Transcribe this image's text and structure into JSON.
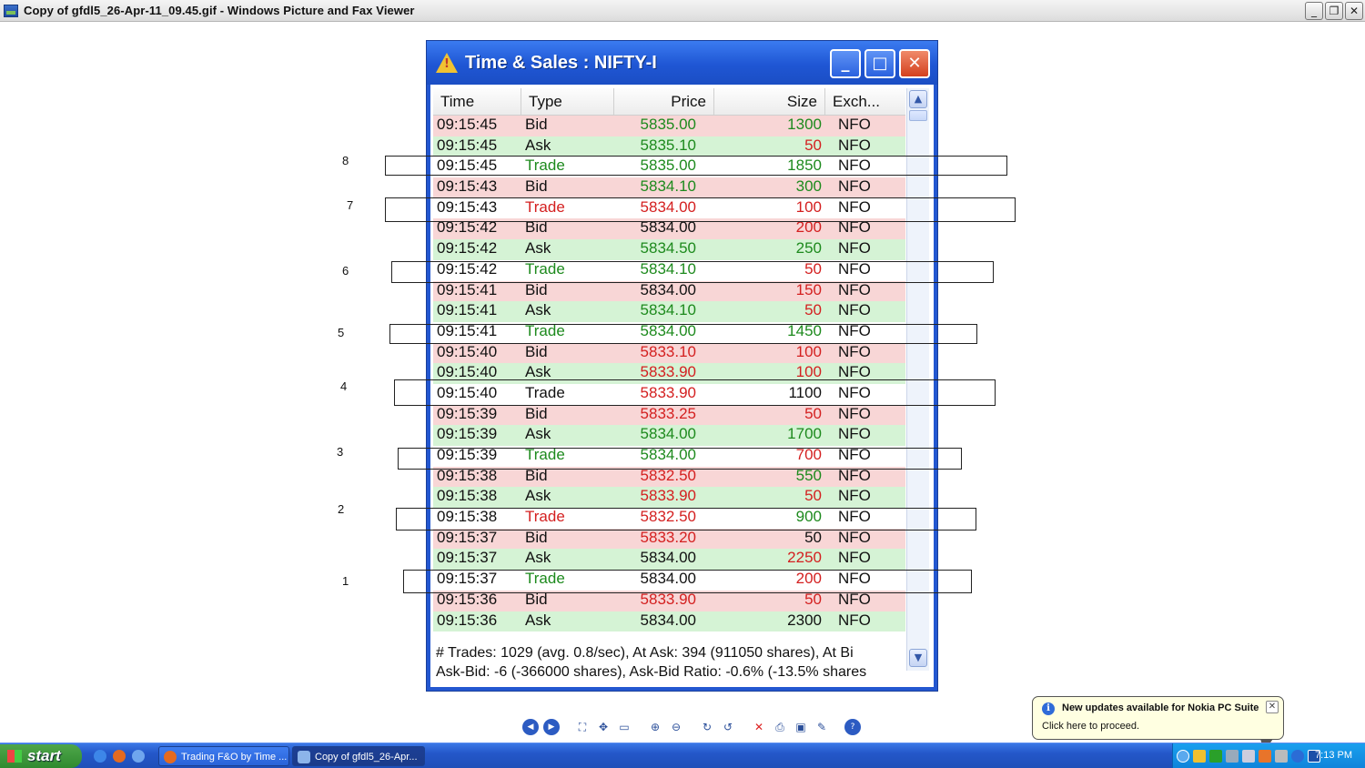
{
  "viewer": {
    "title": "Copy of gfdl5_26-Apr-11_09.45.gif - Windows Picture and Fax Viewer",
    "buttons": {
      "minimize": "_",
      "restore": "❐",
      "close": "✕"
    }
  },
  "ts_window": {
    "title": "Time & Sales : NIFTY-I",
    "buttons": {
      "minimize": "_",
      "maximize": "□",
      "close": "✕"
    },
    "columns": [
      "Time",
      "Type",
      "Price",
      "Size",
      "Exch..."
    ],
    "rows": [
      {
        "time": "09:15:45",
        "type": "Bid",
        "price": "5835.00",
        "size": "1300",
        "exch": "NFO",
        "kind": "bid",
        "type_color": "#111111",
        "price_color": "#1d8a1d",
        "size_color": "#1d8a1d"
      },
      {
        "time": "09:15:45",
        "type": "Ask",
        "price": "5835.10",
        "size": "50",
        "exch": "NFO",
        "kind": "ask",
        "type_color": "#111111",
        "price_color": "#1d8a1d",
        "size_color": "#d42020"
      },
      {
        "time": "09:15:45",
        "type": "Trade",
        "price": "5835.00",
        "size": "1850",
        "exch": "NFO",
        "kind": "trade",
        "type_color": "#1d8a1d",
        "price_color": "#1d8a1d",
        "size_color": "#1d8a1d"
      },
      {
        "time": "09:15:43",
        "type": "Bid",
        "price": "5834.10",
        "size": "300",
        "exch": "NFO",
        "kind": "bid",
        "type_color": "#111111",
        "price_color": "#1d8a1d",
        "size_color": "#1d8a1d"
      },
      {
        "time": "09:15:43",
        "type": "Trade",
        "price": "5834.00",
        "size": "100",
        "exch": "NFO",
        "kind": "trade",
        "type_color": "#d42020",
        "price_color": "#d42020",
        "size_color": "#d42020"
      },
      {
        "time": "09:15:42",
        "type": "Bid",
        "price": "5834.00",
        "size": "200",
        "exch": "NFO",
        "kind": "bid",
        "type_color": "#111111",
        "price_color": "#111111",
        "size_color": "#d42020"
      },
      {
        "time": "09:15:42",
        "type": "Ask",
        "price": "5834.50",
        "size": "250",
        "exch": "NFO",
        "kind": "ask",
        "type_color": "#111111",
        "price_color": "#1d8a1d",
        "size_color": "#1d8a1d"
      },
      {
        "time": "09:15:42",
        "type": "Trade",
        "price": "5834.10",
        "size": "50",
        "exch": "NFO",
        "kind": "trade",
        "type_color": "#1d8a1d",
        "price_color": "#1d8a1d",
        "size_color": "#d42020"
      },
      {
        "time": "09:15:41",
        "type": "Bid",
        "price": "5834.00",
        "size": "150",
        "exch": "NFO",
        "kind": "bid",
        "type_color": "#111111",
        "price_color": "#111111",
        "size_color": "#d42020"
      },
      {
        "time": "09:15:41",
        "type": "Ask",
        "price": "5834.10",
        "size": "50",
        "exch": "NFO",
        "kind": "ask",
        "type_color": "#111111",
        "price_color": "#1d8a1d",
        "size_color": "#d42020"
      },
      {
        "time": "09:15:41",
        "type": "Trade",
        "price": "5834.00",
        "size": "1450",
        "exch": "NFO",
        "kind": "trade",
        "type_color": "#1d8a1d",
        "price_color": "#1d8a1d",
        "size_color": "#1d8a1d"
      },
      {
        "time": "09:15:40",
        "type": "Bid",
        "price": "5833.10",
        "size": "100",
        "exch": "NFO",
        "kind": "bid",
        "type_color": "#111111",
        "price_color": "#d42020",
        "size_color": "#d42020"
      },
      {
        "time": "09:15:40",
        "type": "Ask",
        "price": "5833.90",
        "size": "100",
        "exch": "NFO",
        "kind": "ask",
        "type_color": "#111111",
        "price_color": "#d42020",
        "size_color": "#d42020"
      },
      {
        "time": "09:15:40",
        "type": "Trade",
        "price": "5833.90",
        "size": "1100",
        "exch": "NFO",
        "kind": "trade",
        "type_color": "#111111",
        "price_color": "#d42020",
        "size_color": "#111111"
      },
      {
        "time": "09:15:39",
        "type": "Bid",
        "price": "5833.25",
        "size": "50",
        "exch": "NFO",
        "kind": "bid",
        "type_color": "#111111",
        "price_color": "#d42020",
        "size_color": "#d42020"
      },
      {
        "time": "09:15:39",
        "type": "Ask",
        "price": "5834.00",
        "size": "1700",
        "exch": "NFO",
        "kind": "ask",
        "type_color": "#111111",
        "price_color": "#1d8a1d",
        "size_color": "#1d8a1d"
      },
      {
        "time": "09:15:39",
        "type": "Trade",
        "price": "5834.00",
        "size": "700",
        "exch": "NFO",
        "kind": "trade",
        "type_color": "#1d8a1d",
        "price_color": "#1d8a1d",
        "size_color": "#d42020"
      },
      {
        "time": "09:15:38",
        "type": "Bid",
        "price": "5832.50",
        "size": "550",
        "exch": "NFO",
        "kind": "bid",
        "type_color": "#111111",
        "price_color": "#d42020",
        "size_color": "#1d8a1d"
      },
      {
        "time": "09:15:38",
        "type": "Ask",
        "price": "5833.90",
        "size": "50",
        "exch": "NFO",
        "kind": "ask",
        "type_color": "#111111",
        "price_color": "#d42020",
        "size_color": "#d42020"
      },
      {
        "time": "09:15:38",
        "type": "Trade",
        "price": "5832.50",
        "size": "900",
        "exch": "NFO",
        "kind": "trade",
        "type_color": "#d42020",
        "price_color": "#d42020",
        "size_color": "#1d8a1d"
      },
      {
        "time": "09:15:37",
        "type": "Bid",
        "price": "5833.20",
        "size": "50",
        "exch": "NFO",
        "kind": "bid",
        "type_color": "#111111",
        "price_color": "#d42020",
        "size_color": "#111111"
      },
      {
        "time": "09:15:37",
        "type": "Ask",
        "price": "5834.00",
        "size": "2250",
        "exch": "NFO",
        "kind": "ask",
        "type_color": "#111111",
        "price_color": "#111111",
        "size_color": "#d42020"
      },
      {
        "time": "09:15:37",
        "type": "Trade",
        "price": "5834.00",
        "size": "200",
        "exch": "NFO",
        "kind": "trade",
        "type_color": "#1d8a1d",
        "price_color": "#111111",
        "size_color": "#d42020"
      },
      {
        "time": "09:15:36",
        "type": "Bid",
        "price": "5833.90",
        "size": "50",
        "exch": "NFO",
        "kind": "bid",
        "type_color": "#111111",
        "price_color": "#d42020",
        "size_color": "#d42020"
      },
      {
        "time": "09:15:36",
        "type": "Ask",
        "price": "5834.00",
        "size": "2300",
        "exch": "NFO",
        "kind": "ask",
        "type_color": "#111111",
        "price_color": "#111111",
        "size_color": "#111111"
      }
    ],
    "status_line1": "# Trades: 1029 (avg. 0.8/sec), At Ask: 394 (911050 shares), At Bi",
    "status_line2": "Ask-Bid: -6 (-366000 shares), Ask-Bid Ratio: -0.6% (-13.5% shares"
  },
  "annotations": [
    {
      "label": "8"
    },
    {
      "label": "7"
    },
    {
      "label": "6"
    },
    {
      "label": "5"
    },
    {
      "label": "4"
    },
    {
      "label": "3"
    },
    {
      "label": "2"
    },
    {
      "label": "1"
    }
  ],
  "balloon": {
    "title": "New updates available for Nokia PC Suite",
    "text": "Click here to proceed.",
    "close": "✕"
  },
  "taskbar": {
    "start_label": "start",
    "tasks": [
      {
        "label": "Trading F&O by Time ..."
      },
      {
        "label": "Copy of gfdl5_26-Apr..."
      }
    ],
    "clock": "7:13 PM"
  },
  "colors": {
    "bid_bg": "#f8d6d6",
    "ask_bg": "#d5f3d5",
    "trade_bg": "#ffffff",
    "green": "#1d8a1d",
    "red": "#d42020",
    "titlebar_blue": "#1f56d4"
  }
}
